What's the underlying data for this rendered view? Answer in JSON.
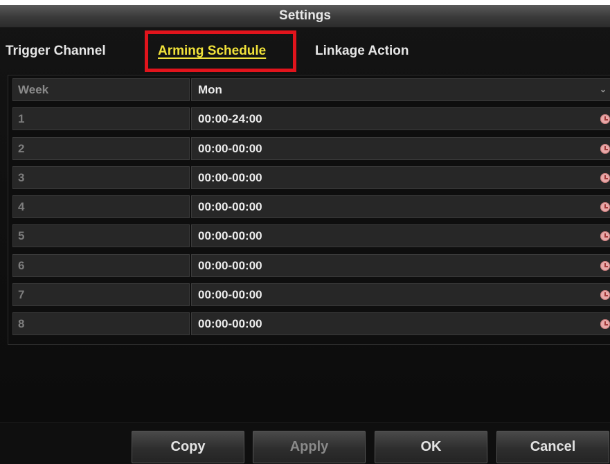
{
  "dialog": {
    "title": "Settings"
  },
  "tabs": [
    {
      "label": "Trigger Channel",
      "active": false
    },
    {
      "label": "Arming Schedule",
      "active": true
    },
    {
      "label": "Linkage Action",
      "active": false
    }
  ],
  "schedule": {
    "week_label": "Week",
    "week_value": "Mon",
    "rows": [
      {
        "index": "1",
        "time": "00:00-24:00"
      },
      {
        "index": "2",
        "time": "00:00-00:00"
      },
      {
        "index": "3",
        "time": "00:00-00:00"
      },
      {
        "index": "4",
        "time": "00:00-00:00"
      },
      {
        "index": "5",
        "time": "00:00-00:00"
      },
      {
        "index": "6",
        "time": "00:00-00:00"
      },
      {
        "index": "7",
        "time": "00:00-00:00"
      },
      {
        "index": "8",
        "time": "00:00-00:00"
      }
    ]
  },
  "buttons": {
    "copy": "Copy",
    "apply": "Apply",
    "ok": "OK",
    "cancel": "Cancel"
  },
  "icons": {
    "clock": "clock-icon",
    "dropdown": "chevron-down-icon"
  },
  "colors": {
    "active_tab": "#f1e23a",
    "highlight_border": "#e1141c",
    "clock_icon": "#e8a9a9"
  }
}
